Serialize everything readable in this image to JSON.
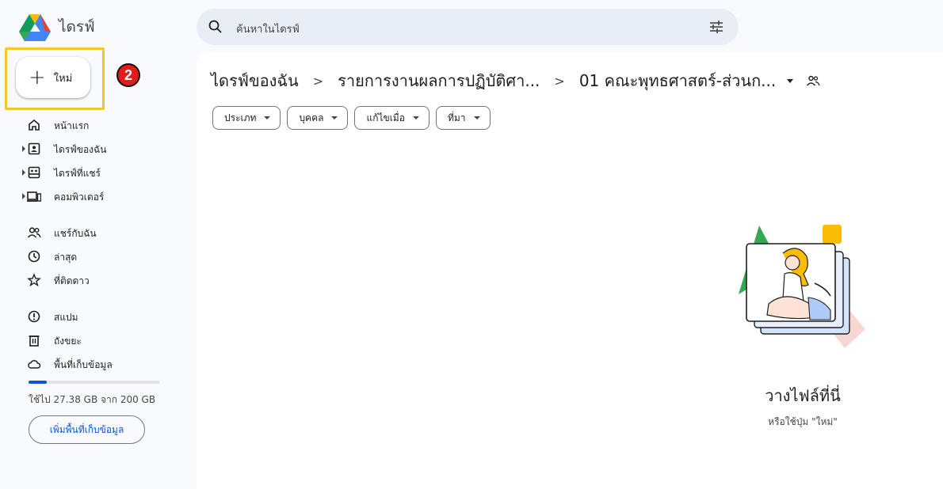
{
  "app": {
    "title": "ไดรฟ์"
  },
  "search": {
    "placeholder": "ค้นหาในไดรฟ์"
  },
  "sidebar": {
    "new_button_label": "ใหม่",
    "step_badge": "2",
    "items": [
      {
        "label": "หน้าแรก",
        "icon": "home-icon"
      },
      {
        "label": "ไดรฟ์ของฉัน",
        "icon": "my-drive-icon",
        "expandable": true
      },
      {
        "label": "ไดรฟ์ที่แชร์",
        "icon": "shared-drives-icon",
        "expandable": true
      },
      {
        "label": "คอมพิวเตอร์",
        "icon": "computers-icon",
        "expandable": true
      },
      {
        "label": "แชร์กับฉัน",
        "icon": "people-icon"
      },
      {
        "label": "ล่าสุด",
        "icon": "clock-icon"
      },
      {
        "label": "ที่ติดดาว",
        "icon": "star-icon"
      },
      {
        "label": "สแปม",
        "icon": "spam-icon"
      },
      {
        "label": "ถังขยะ",
        "icon": "trash-icon"
      },
      {
        "label": "พื้นที่เก็บข้อมูล",
        "icon": "cloud-icon"
      }
    ],
    "storage": {
      "used_text": "ใช้ไป 27.38 GB จาก 200 GB",
      "used_fraction": 0.137,
      "button_label": "เพิ่มพื้นที่เก็บข้อมูล"
    }
  },
  "breadcrumb": {
    "items": [
      "ไดรฟ์ของฉัน",
      "รายการงานผลการปฏิบัติศา...",
      "01 คณะพุทธศาสตร์-ส่วนก..."
    ],
    "separator": ">"
  },
  "filters": [
    "ประเภท",
    "บุคคล",
    "แก้ไขเมื่อ",
    "ที่มา"
  ],
  "empty_state": {
    "title": "วางไฟล์ที่นี่",
    "subtitle": "หรือใช้ปุ่ม \"ใหม่\""
  },
  "colors": {
    "accent": "#0b57d0",
    "highlight": "#f4c72b",
    "badge": "#e21b1b",
    "background": "#f8fafd"
  }
}
